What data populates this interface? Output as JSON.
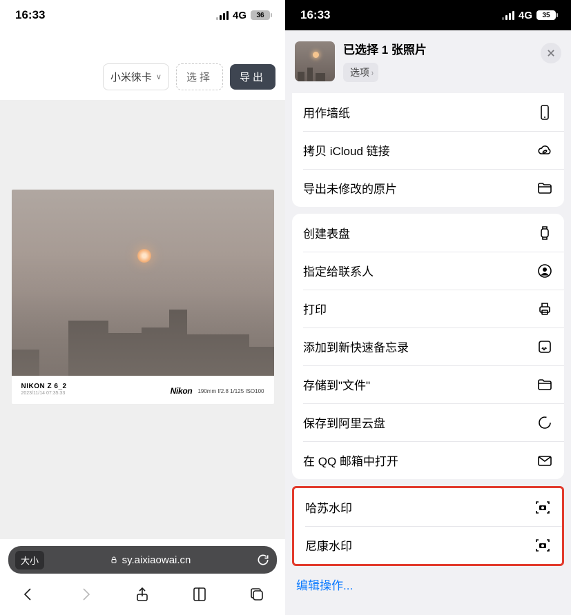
{
  "left": {
    "status": {
      "time": "16:33",
      "signal": "4G",
      "battery": "36"
    },
    "toolbar": {
      "dropdown_label": "小米徕卡",
      "select_label": "选择",
      "export_label": "导出"
    },
    "photo_footer": {
      "camera": "NIKON Z 6_2",
      "date": "2023/11/14 07:35:33",
      "brand": "Nikon",
      "exif": "190mm f/2.8 1/125 ISO100"
    },
    "address_bar": {
      "left_pill": "大小",
      "url": "sy.aixiaowai.cn"
    }
  },
  "right": {
    "status": {
      "time": "16:33",
      "signal": "4G",
      "battery": "35"
    },
    "header": {
      "title": "已选择 1 张照片",
      "options": "选项"
    },
    "group1": [
      {
        "label": "用作墙纸",
        "icon": "phone"
      },
      {
        "label": "拷贝 iCloud 链接",
        "icon": "cloud-link"
      },
      {
        "label": "导出未修改的原片",
        "icon": "folder"
      }
    ],
    "group2": [
      {
        "label": "创建表盘",
        "icon": "watch"
      },
      {
        "label": "指定给联系人",
        "icon": "contact"
      },
      {
        "label": "打印",
        "icon": "printer"
      },
      {
        "label": "添加到新快速备忘录",
        "icon": "note"
      },
      {
        "label": "存储到\"文件\"",
        "icon": "folder"
      },
      {
        "label": "保存到阿里云盘",
        "icon": "circle-arrow"
      },
      {
        "label": "在 QQ 邮箱中打开",
        "icon": "mail"
      }
    ],
    "group3": [
      {
        "label": "哈苏水印",
        "icon": "camera-frame"
      },
      {
        "label": "尼康水印",
        "icon": "camera-frame"
      }
    ],
    "edit_actions": "编辑操作..."
  }
}
